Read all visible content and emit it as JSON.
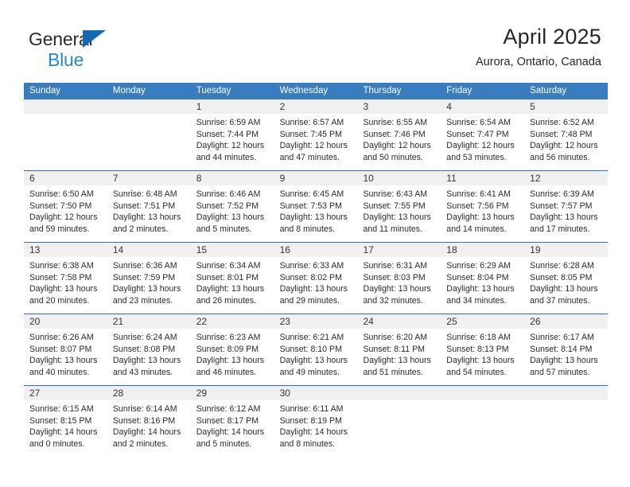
{
  "brand": {
    "name_top": "General",
    "name_bottom": "Blue",
    "triangle_color": "#1667b1",
    "blue_text_color": "#2a86d6"
  },
  "header": {
    "title": "April 2025",
    "location": "Aurora, Ontario, Canada"
  },
  "theme": {
    "header_blue": "#3a7dbf",
    "row_divider_blue": "#2f6fae",
    "date_band_gray": "#f0f0f0"
  },
  "weekdays": [
    "Sunday",
    "Monday",
    "Tuesday",
    "Wednesday",
    "Thursday",
    "Friday",
    "Saturday"
  ],
  "weeks": [
    [
      {
        "day": "",
        "sunrise": "",
        "sunset": "",
        "daylight1": "",
        "daylight2": ""
      },
      {
        "day": "",
        "sunrise": "",
        "sunset": "",
        "daylight1": "",
        "daylight2": ""
      },
      {
        "day": "1",
        "sunrise": "Sunrise: 6:59 AM",
        "sunset": "Sunset: 7:44 PM",
        "daylight1": "Daylight: 12 hours",
        "daylight2": "and 44 minutes."
      },
      {
        "day": "2",
        "sunrise": "Sunrise: 6:57 AM",
        "sunset": "Sunset: 7:45 PM",
        "daylight1": "Daylight: 12 hours",
        "daylight2": "and 47 minutes."
      },
      {
        "day": "3",
        "sunrise": "Sunrise: 6:55 AM",
        "sunset": "Sunset: 7:46 PM",
        "daylight1": "Daylight: 12 hours",
        "daylight2": "and 50 minutes."
      },
      {
        "day": "4",
        "sunrise": "Sunrise: 6:54 AM",
        "sunset": "Sunset: 7:47 PM",
        "daylight1": "Daylight: 12 hours",
        "daylight2": "and 53 minutes."
      },
      {
        "day": "5",
        "sunrise": "Sunrise: 6:52 AM",
        "sunset": "Sunset: 7:48 PM",
        "daylight1": "Daylight: 12 hours",
        "daylight2": "and 56 minutes."
      }
    ],
    [
      {
        "day": "6",
        "sunrise": "Sunrise: 6:50 AM",
        "sunset": "Sunset: 7:50 PM",
        "daylight1": "Daylight: 12 hours",
        "daylight2": "and 59 minutes."
      },
      {
        "day": "7",
        "sunrise": "Sunrise: 6:48 AM",
        "sunset": "Sunset: 7:51 PM",
        "daylight1": "Daylight: 13 hours",
        "daylight2": "and 2 minutes."
      },
      {
        "day": "8",
        "sunrise": "Sunrise: 6:46 AM",
        "sunset": "Sunset: 7:52 PM",
        "daylight1": "Daylight: 13 hours",
        "daylight2": "and 5 minutes."
      },
      {
        "day": "9",
        "sunrise": "Sunrise: 6:45 AM",
        "sunset": "Sunset: 7:53 PM",
        "daylight1": "Daylight: 13 hours",
        "daylight2": "and 8 minutes."
      },
      {
        "day": "10",
        "sunrise": "Sunrise: 6:43 AM",
        "sunset": "Sunset: 7:55 PM",
        "daylight1": "Daylight: 13 hours",
        "daylight2": "and 11 minutes."
      },
      {
        "day": "11",
        "sunrise": "Sunrise: 6:41 AM",
        "sunset": "Sunset: 7:56 PM",
        "daylight1": "Daylight: 13 hours",
        "daylight2": "and 14 minutes."
      },
      {
        "day": "12",
        "sunrise": "Sunrise: 6:39 AM",
        "sunset": "Sunset: 7:57 PM",
        "daylight1": "Daylight: 13 hours",
        "daylight2": "and 17 minutes."
      }
    ],
    [
      {
        "day": "13",
        "sunrise": "Sunrise: 6:38 AM",
        "sunset": "Sunset: 7:58 PM",
        "daylight1": "Daylight: 13 hours",
        "daylight2": "and 20 minutes."
      },
      {
        "day": "14",
        "sunrise": "Sunrise: 6:36 AM",
        "sunset": "Sunset: 7:59 PM",
        "daylight1": "Daylight: 13 hours",
        "daylight2": "and 23 minutes."
      },
      {
        "day": "15",
        "sunrise": "Sunrise: 6:34 AM",
        "sunset": "Sunset: 8:01 PM",
        "daylight1": "Daylight: 13 hours",
        "daylight2": "and 26 minutes."
      },
      {
        "day": "16",
        "sunrise": "Sunrise: 6:33 AM",
        "sunset": "Sunset: 8:02 PM",
        "daylight1": "Daylight: 13 hours",
        "daylight2": "and 29 minutes."
      },
      {
        "day": "17",
        "sunrise": "Sunrise: 6:31 AM",
        "sunset": "Sunset: 8:03 PM",
        "daylight1": "Daylight: 13 hours",
        "daylight2": "and 32 minutes."
      },
      {
        "day": "18",
        "sunrise": "Sunrise: 6:29 AM",
        "sunset": "Sunset: 8:04 PM",
        "daylight1": "Daylight: 13 hours",
        "daylight2": "and 34 minutes."
      },
      {
        "day": "19",
        "sunrise": "Sunrise: 6:28 AM",
        "sunset": "Sunset: 8:05 PM",
        "daylight1": "Daylight: 13 hours",
        "daylight2": "and 37 minutes."
      }
    ],
    [
      {
        "day": "20",
        "sunrise": "Sunrise: 6:26 AM",
        "sunset": "Sunset: 8:07 PM",
        "daylight1": "Daylight: 13 hours",
        "daylight2": "and 40 minutes."
      },
      {
        "day": "21",
        "sunrise": "Sunrise: 6:24 AM",
        "sunset": "Sunset: 8:08 PM",
        "daylight1": "Daylight: 13 hours",
        "daylight2": "and 43 minutes."
      },
      {
        "day": "22",
        "sunrise": "Sunrise: 6:23 AM",
        "sunset": "Sunset: 8:09 PM",
        "daylight1": "Daylight: 13 hours",
        "daylight2": "and 46 minutes."
      },
      {
        "day": "23",
        "sunrise": "Sunrise: 6:21 AM",
        "sunset": "Sunset: 8:10 PM",
        "daylight1": "Daylight: 13 hours",
        "daylight2": "and 49 minutes."
      },
      {
        "day": "24",
        "sunrise": "Sunrise: 6:20 AM",
        "sunset": "Sunset: 8:11 PM",
        "daylight1": "Daylight: 13 hours",
        "daylight2": "and 51 minutes."
      },
      {
        "day": "25",
        "sunrise": "Sunrise: 6:18 AM",
        "sunset": "Sunset: 8:13 PM",
        "daylight1": "Daylight: 13 hours",
        "daylight2": "and 54 minutes."
      },
      {
        "day": "26",
        "sunrise": "Sunrise: 6:17 AM",
        "sunset": "Sunset: 8:14 PM",
        "daylight1": "Daylight: 13 hours",
        "daylight2": "and 57 minutes."
      }
    ],
    [
      {
        "day": "27",
        "sunrise": "Sunrise: 6:15 AM",
        "sunset": "Sunset: 8:15 PM",
        "daylight1": "Daylight: 14 hours",
        "daylight2": "and 0 minutes."
      },
      {
        "day": "28",
        "sunrise": "Sunrise: 6:14 AM",
        "sunset": "Sunset: 8:16 PM",
        "daylight1": "Daylight: 14 hours",
        "daylight2": "and 2 minutes."
      },
      {
        "day": "29",
        "sunrise": "Sunrise: 6:12 AM",
        "sunset": "Sunset: 8:17 PM",
        "daylight1": "Daylight: 14 hours",
        "daylight2": "and 5 minutes."
      },
      {
        "day": "30",
        "sunrise": "Sunrise: 6:11 AM",
        "sunset": "Sunset: 8:19 PM",
        "daylight1": "Daylight: 14 hours",
        "daylight2": "and 8 minutes."
      },
      {
        "day": "",
        "sunrise": "",
        "sunset": "",
        "daylight1": "",
        "daylight2": ""
      },
      {
        "day": "",
        "sunrise": "",
        "sunset": "",
        "daylight1": "",
        "daylight2": ""
      },
      {
        "day": "",
        "sunrise": "",
        "sunset": "",
        "daylight1": "",
        "daylight2": ""
      }
    ]
  ]
}
